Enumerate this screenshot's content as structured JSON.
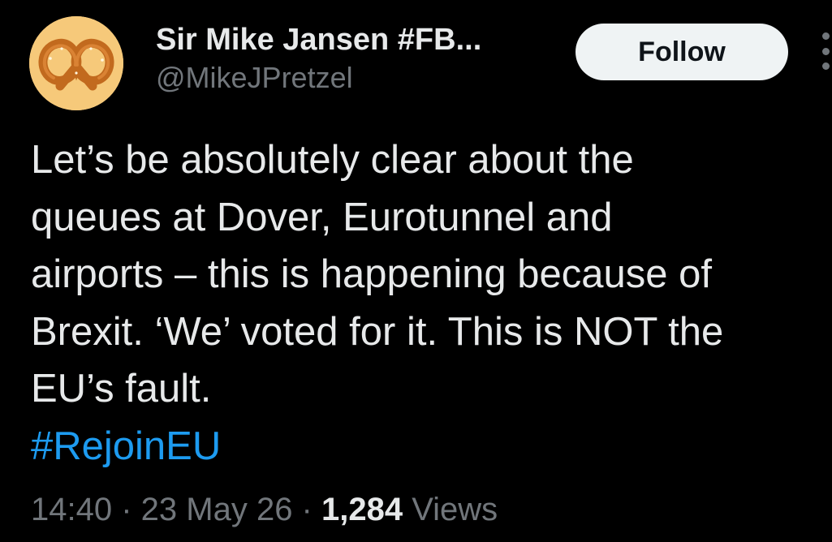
{
  "author": {
    "display_name": "Sir Mike Jansen #FB...",
    "handle": "@MikeJPretzel",
    "avatar_icon": "pretzel-icon"
  },
  "follow_label": "Follow",
  "tweet": {
    "lines": [
      "Let’s be absolutely clear about the",
      "queues at Dover, Eurotunnel and",
      "airports – this is happening because of",
      "Brexit. ‘We’ voted for it. This is NOT the",
      "EU’s fault."
    ],
    "hashtag": "#RejoinEU"
  },
  "meta": {
    "time": "14:40",
    "separator": " · ",
    "date": "23 May 26",
    "views_count": "1,284",
    "views_label": " Views"
  },
  "colors": {
    "background": "#000000",
    "text": "#e7e9ea",
    "secondary": "#71767b",
    "link": "#1d9bf0",
    "follow_bg": "#eff3f4"
  }
}
